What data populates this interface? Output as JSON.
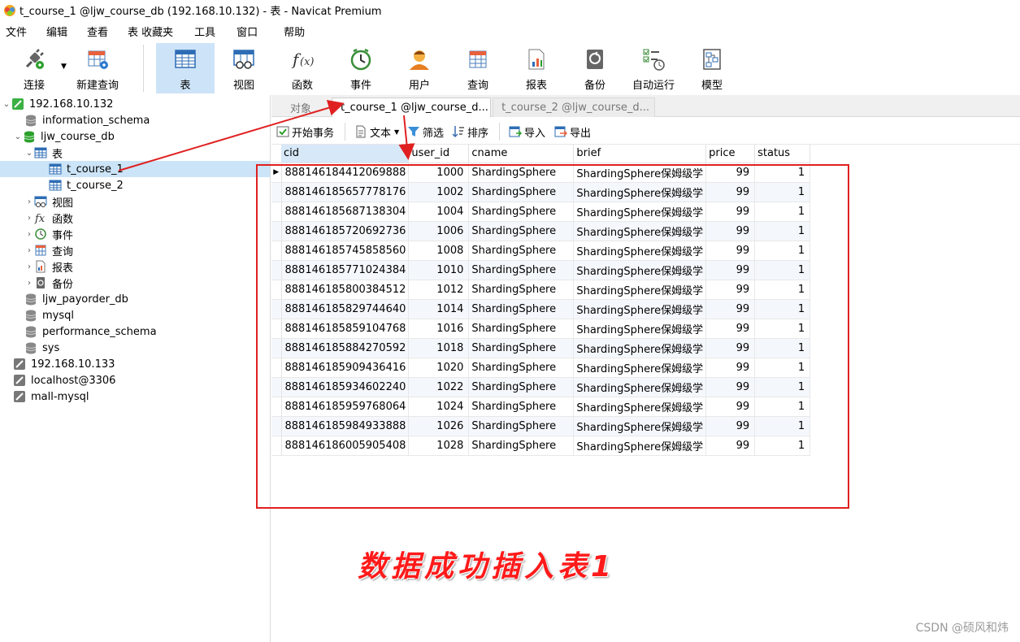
{
  "window": {
    "title": "t_course_1 @ljw_course_db (192.168.10.132) - 表 - Navicat Premium"
  },
  "menu": [
    "文件",
    "编辑",
    "查看",
    "表",
    "收藏夹",
    "工具",
    "窗口",
    "帮助"
  ],
  "toolbar": {
    "connect": "连接",
    "new_query": "新建查询",
    "table": "表",
    "view": "视图",
    "function": "函数",
    "event": "事件",
    "user": "用户",
    "query": "查询",
    "report": "报表",
    "backup": "备份",
    "automation": "自动运行",
    "model": "模型"
  },
  "tree": {
    "conn1": "192.168.10.132",
    "db_info": "information_schema",
    "db_course": "ljw_course_db",
    "folder_tables": "表",
    "table1": "t_course_1",
    "table2": "t_course_2",
    "folder_views": "视图",
    "folder_functions": "函数",
    "folder_events": "事件",
    "folder_queries": "查询",
    "folder_reports": "报表",
    "folder_backups": "备份",
    "db_payorder": "ljw_payorder_db",
    "db_mysql": "mysql",
    "db_perf": "performance_schema",
    "db_sys": "sys",
    "conn2": "192.168.10.133",
    "conn3": "localhost@3306",
    "conn4": "mall-mysql"
  },
  "tabs": {
    "objects": "对象",
    "active": "t_course_1 @ljw_course_d...",
    "inactive": "t_course_2 @ljw_course_d..."
  },
  "subtoolbar": {
    "begin_tx": "开始事务",
    "text": "文本",
    "filter": "筛选",
    "sort": "排序",
    "import": "导入",
    "export": "导出"
  },
  "grid": {
    "columns": [
      "cid",
      "user_id",
      "cname",
      "brief",
      "price",
      "status"
    ],
    "rows": [
      [
        "888146184412069888",
        "1000",
        "ShardingSphere",
        "ShardingSphere保姆级学",
        "99",
        "1"
      ],
      [
        "888146185657778176",
        "1002",
        "ShardingSphere",
        "ShardingSphere保姆级学",
        "99",
        "1"
      ],
      [
        "888146185687138304",
        "1004",
        "ShardingSphere",
        "ShardingSphere保姆级学",
        "99",
        "1"
      ],
      [
        "888146185720692736",
        "1006",
        "ShardingSphere",
        "ShardingSphere保姆级学",
        "99",
        "1"
      ],
      [
        "888146185745858560",
        "1008",
        "ShardingSphere",
        "ShardingSphere保姆级学",
        "99",
        "1"
      ],
      [
        "888146185771024384",
        "1010",
        "ShardingSphere",
        "ShardingSphere保姆级学",
        "99",
        "1"
      ],
      [
        "888146185800384512",
        "1012",
        "ShardingSphere",
        "ShardingSphere保姆级学",
        "99",
        "1"
      ],
      [
        "888146185829744640",
        "1014",
        "ShardingSphere",
        "ShardingSphere保姆级学",
        "99",
        "1"
      ],
      [
        "888146185859104768",
        "1016",
        "ShardingSphere",
        "ShardingSphere保姆级学",
        "99",
        "1"
      ],
      [
        "888146185884270592",
        "1018",
        "ShardingSphere",
        "ShardingSphere保姆级学",
        "99",
        "1"
      ],
      [
        "888146185909436416",
        "1020",
        "ShardingSphere",
        "ShardingSphere保姆级学",
        "99",
        "1"
      ],
      [
        "888146185934602240",
        "1022",
        "ShardingSphere",
        "ShardingSphere保姆级学",
        "99",
        "1"
      ],
      [
        "888146185959768064",
        "1024",
        "ShardingSphere",
        "ShardingSphere保姆级学",
        "99",
        "1"
      ],
      [
        "888146185984933888",
        "1026",
        "ShardingSphere",
        "ShardingSphere保姆级学",
        "99",
        "1"
      ],
      [
        "888146186005905408",
        "1028",
        "ShardingSphere",
        "ShardingSphere保姆级学",
        "99",
        "1"
      ]
    ]
  },
  "annotation": {
    "text": "数据成功插入表1",
    "color": "#e02020"
  },
  "watermark": "CSDN @硕风和炜",
  "colors": {
    "accent": "#cde3f7",
    "selection": "#cce4f7",
    "annotation": "#e02020"
  }
}
